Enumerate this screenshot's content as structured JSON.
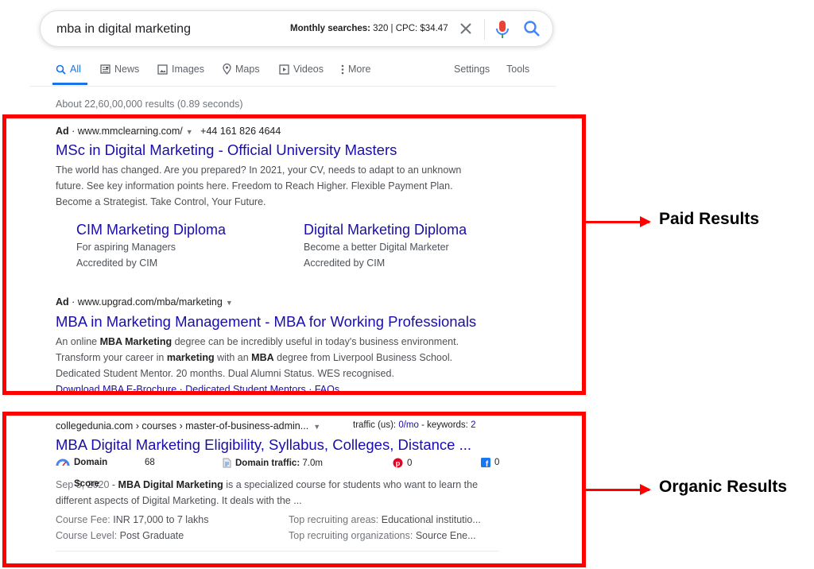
{
  "search": {
    "query": "mba in digital marketing",
    "keyword_label": "Monthly searches:",
    "keyword_rest": " 320 | CPC: $34.47"
  },
  "tabs": [
    {
      "label": "All",
      "icon": "search-icon",
      "active": true
    },
    {
      "label": "News",
      "icon": "news-icon"
    },
    {
      "label": "Images",
      "icon": "image-icon"
    },
    {
      "label": "Maps",
      "icon": "map-pin-icon"
    },
    {
      "label": "Videos",
      "icon": "video-icon"
    },
    {
      "label": "More",
      "icon": "more-vert-icon"
    },
    {
      "label": "Settings"
    },
    {
      "label": "Tools"
    }
  ],
  "stats": "About 22,60,00,000 results (0.89 seconds)",
  "ad1": {
    "ad_label": "Ad",
    "url": "www.mmclearning.com/",
    "phone": "+44 161 826 4644",
    "title": "MSc in Digital Marketing - Official University Masters",
    "desc": [
      "The world has changed. Are you prepared? In 2021, your CV, needs to adapt to an unknown",
      "future. See key information points here. Freedom to Reach Higher. Flexible Payment Plan.",
      "Become a Strategist. Take Control, Your Future."
    ],
    "sitelinks": [
      {
        "title": "CIM Marketing Diploma",
        "line1": "For aspiring Managers",
        "line2": "Accredited by CIM"
      },
      {
        "title": "Digital Marketing Diploma",
        "line1": "Become a better Digital Marketer",
        "line2": "Accredited by CIM"
      }
    ]
  },
  "ad2": {
    "ad_label": "Ad",
    "url": "www.upgrad.com/mba/marketing",
    "title": "MBA in Marketing Management - MBA for Working Professionals",
    "desc1_a": "An online ",
    "desc1_b": "MBA Marketing",
    "desc1_c": " degree can be incredibly useful in today's business environment.",
    "desc2_a": "Transform your career in ",
    "desc2_b": "marketing",
    "desc2_c": " with an ",
    "desc2_d": "MBA",
    "desc2_e": " degree from Liverpool Business School.",
    "desc3": "Dedicated Student Mentor. 20 months. Dual Alumni Status. WES recognised.",
    "links": "Download MBA E-Brochure · Dedicated Student Mentors · FAQs"
  },
  "organic": {
    "cite": "collegedunia.com › courses › master-of-business-admin...",
    "traffic_label": "traffic (us): ",
    "traffic_value": "0/mo",
    "keywords_label": " - keywords: ",
    "keywords_value": "2",
    "title": "MBA Digital Marketing Eligibility, Syllabus, Colleges, Distance ...",
    "domain_label": "Domain",
    "domain_score_label": "Score",
    "domain_score": "68",
    "domain_traffic_label": "Domain traffic:",
    "domain_traffic_value": " 7.0m",
    "pinterest_count": "0",
    "facebook_count": "0",
    "date": "Sep 5, 2020",
    "desc1_a": " - ",
    "desc1_b": "MBA Digital Marketing",
    "desc1_c": " is a specialized course for students who want to learn the",
    "desc2": "different aspects of Digital Marketing. It deals with the ...",
    "facts": [
      {
        "label": "Course Fee: ",
        "value": "INR 17,000 to 7 lakhs"
      },
      {
        "label": "Course Level: ",
        "value": "Post Graduate"
      },
      {
        "label": "Top recruiting areas: ",
        "value": "Educational institutio..."
      },
      {
        "label": "Top recruiting organizations: ",
        "value": "Source Ene..."
      }
    ]
  },
  "callouts": {
    "paid": "Paid Results",
    "organic": "Organic Results"
  },
  "colors": {
    "annotation": "#ff0000",
    "link": "#1a0dab",
    "accent": "#1a73e8"
  }
}
